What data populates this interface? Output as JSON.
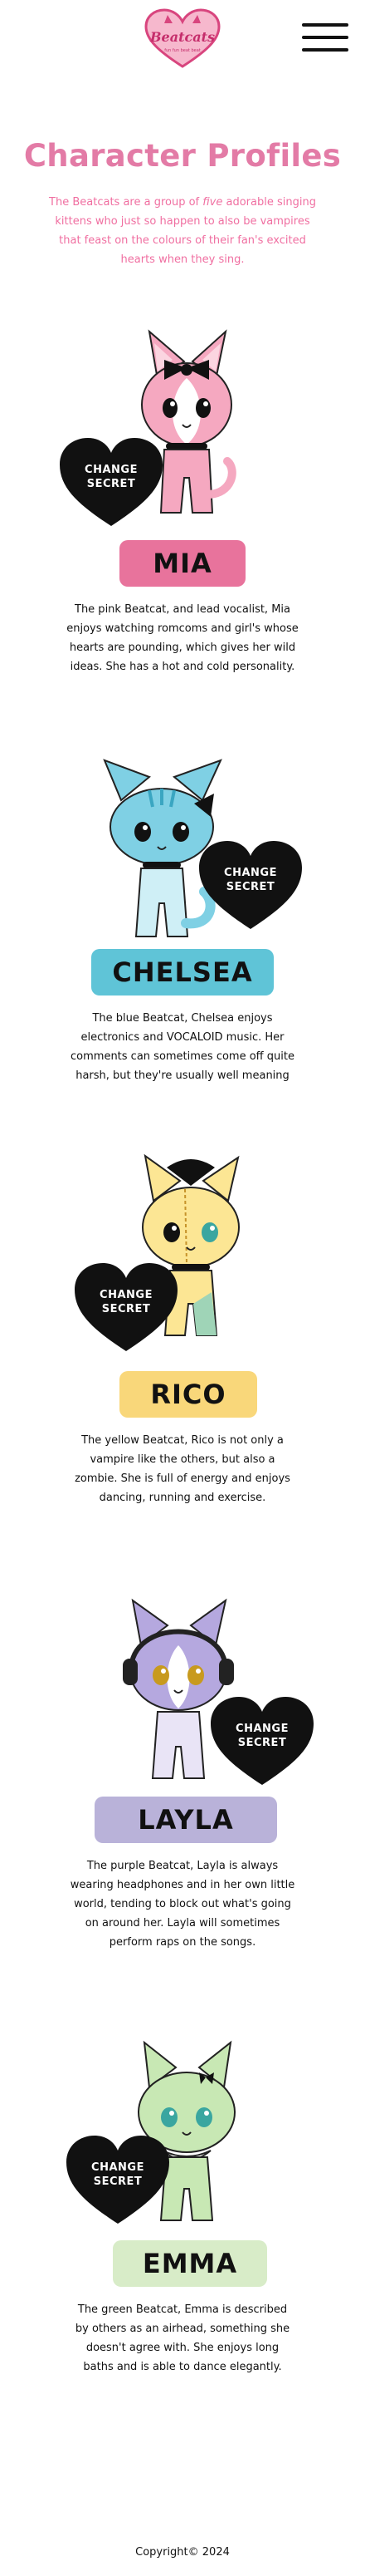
{
  "header": {
    "logo_icon": "beatcats-heart-logo",
    "menu_icon": "hamburger-menu-icon"
  },
  "intro": {
    "title": "Character Profiles",
    "text_before": "The Beatcats are a group of ",
    "text_emphasis": "five",
    "text_after": " adorable singing kittens who just so happen to also be vampires that feast on the colours of their fan's excited hearts when they sing."
  },
  "characters": [
    {
      "name": "MIA",
      "button": "CHANGE SECRET",
      "color": "#e8739c",
      "description": "The pink Beatcat, and lead vocalist, Mia enjoys watching romcoms and girl's whose hearts are pounding, which gives her wild ideas. She has a hot and cold personality."
    },
    {
      "name": "CHELSEA",
      "button": "CHANGE SECRET",
      "color": "#5fc4d7",
      "description": "The blue Beatcat, Chelsea enjoys electronics and VOCALOID music. Her comments can sometimes come off quite harsh, but they're usually well meaning"
    },
    {
      "name": "RICO",
      "button": "CHANGE SECRET",
      "color": "#f9d77a",
      "description": "The yellow Beatcat, Rico is not only a vampire like the others, but also a zombie. She is full of energy and enjoys dancing, running and exercise."
    },
    {
      "name": "LAYLA",
      "button": "CHANGE SECRET",
      "color": "#b9b2d9",
      "description": "The purple Beatcat, Layla is always wearing headphones and in her own little world, tending to block out what's going on around her. Layla will sometimes perform raps on the songs."
    },
    {
      "name": "EMMA",
      "button": "CHANGE SECRET",
      "color": "#d8ecc8",
      "description": "The green Beatcat, Emma is described by others as an airhead, something she doesn't agree with. She enjoys long baths and is able to dance elegantly."
    }
  ],
  "footer": {
    "copyright": "Copyright© 2024"
  }
}
